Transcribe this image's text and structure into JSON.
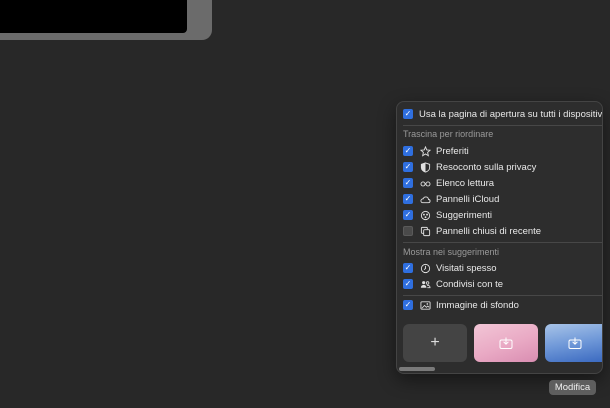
{
  "panel": {
    "use_start_page": {
      "label": "Usa la pagina di apertura su tutti i dispositivi",
      "checked": true
    },
    "reorder_header": "Trascina per riordinare",
    "sections": [
      {
        "label": "Preferiti",
        "checked": true,
        "icon": "star-icon"
      },
      {
        "label": "Resoconto sulla privacy",
        "checked": true,
        "icon": "privacy-shield-icon"
      },
      {
        "label": "Elenco lettura",
        "checked": true,
        "icon": "glasses-icon"
      },
      {
        "label": "Pannelli iCloud",
        "checked": true,
        "icon": "cloud-icon"
      },
      {
        "label": "Suggerimenti",
        "checked": true,
        "icon": "siri-suggestions-icon"
      },
      {
        "label": "Pannelli chiusi di recente",
        "checked": false,
        "icon": "tabs-icon"
      }
    ],
    "suggestions_header": "Mostra nei suggerimenti",
    "suggestions": [
      {
        "label": "Visitati spesso",
        "checked": true,
        "icon": "clock-icon"
      },
      {
        "label": "Condivisi con te",
        "checked": true,
        "icon": "people-icon"
      }
    ],
    "background": {
      "label": "Immagine di sfondo",
      "checked": true,
      "icon": "image-icon"
    },
    "add_tile_glyph": "+"
  },
  "tooltip": "Modifica",
  "colors": {
    "accent": "#2f6fe0",
    "background": "#282828",
    "panel": "#2d2d2d"
  }
}
